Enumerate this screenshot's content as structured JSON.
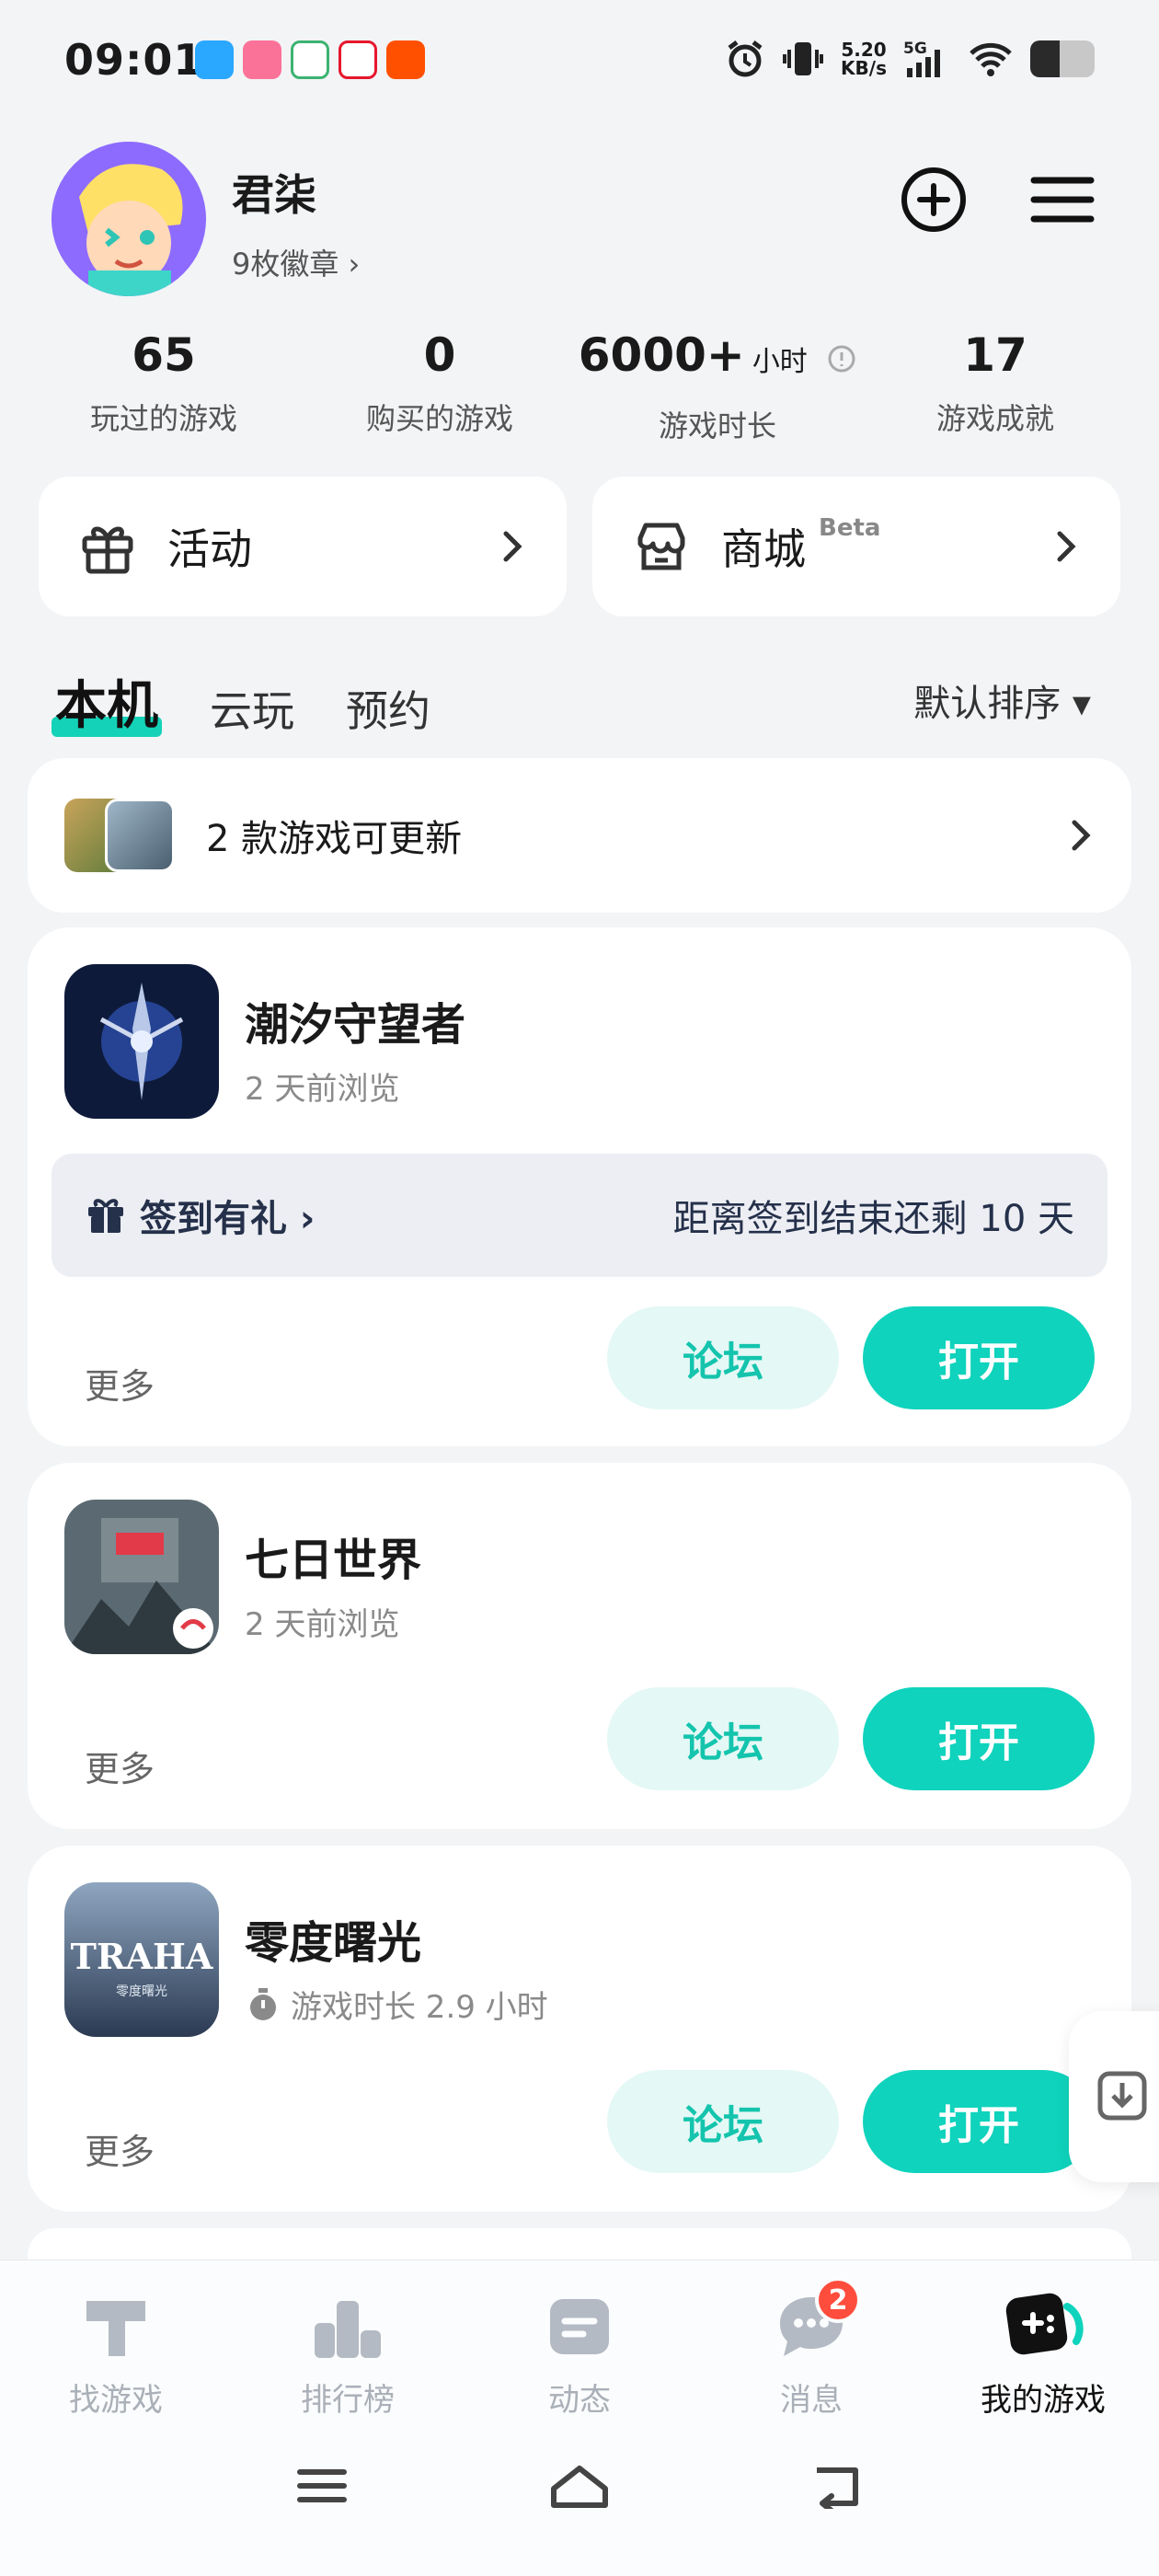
{
  "status_bar": {
    "time": "09:01",
    "app_icons": [
      "bilibili-icon",
      "wen-icon",
      "weibo-icon",
      "taobao-icon"
    ],
    "speed_value": "5.20",
    "speed_unit": "KB/s",
    "network": "5G",
    "battery_level": 0.45
  },
  "profile": {
    "username": "君柒",
    "badges": "9枚徽章 ›"
  },
  "stats": [
    {
      "value": "65",
      "label": "玩过的游戏"
    },
    {
      "value": "0",
      "label": "购买的游戏"
    },
    {
      "value": "6000+",
      "unit": "小时",
      "label": "游戏时长"
    },
    {
      "value": "17",
      "label": "游戏成就"
    }
  ],
  "quick_links": {
    "activity": "活动",
    "shop": "商城",
    "shop_tag": "Beta"
  },
  "tabs": [
    {
      "label": "本机",
      "active": true
    },
    {
      "label": "云玩",
      "active": false
    },
    {
      "label": "预约",
      "active": false
    }
  ],
  "sort_label": "默认排序 ▾",
  "update_bar": {
    "text": "2 款游戏可更新"
  },
  "games": [
    {
      "name": "潮汐守望者",
      "subtitle": "2 天前浏览",
      "signin_label": "签到有礼 ›",
      "signin_remaining": "距离签到结束还剩 10 天",
      "more": "更多",
      "forum": "论坛",
      "open": "打开"
    },
    {
      "name": "七日世界",
      "subtitle": "2 天前浏览",
      "more": "更多",
      "forum": "论坛",
      "open": "打开"
    },
    {
      "name": "零度曙光",
      "subtitle": "游戏时长 2.9 小时",
      "icon_text": "TRAHA",
      "icon_subtext": "零度曙光",
      "more": "更多",
      "forum": "论坛",
      "open": "打开"
    }
  ],
  "bottom_nav": [
    {
      "label": "找游戏",
      "icon": "find-game-icon"
    },
    {
      "label": "排行榜",
      "icon": "ranking-icon"
    },
    {
      "label": "动态",
      "icon": "feed-icon"
    },
    {
      "label": "消息",
      "icon": "message-icon",
      "badge": "2"
    },
    {
      "label": "我的游戏",
      "icon": "my-games-icon",
      "active": true
    }
  ],
  "colors": {
    "accent": "#0fd3bc",
    "accent_light": "#e4f8f5",
    "badge": "#ff4d3d",
    "background": "#f2f4f6"
  }
}
